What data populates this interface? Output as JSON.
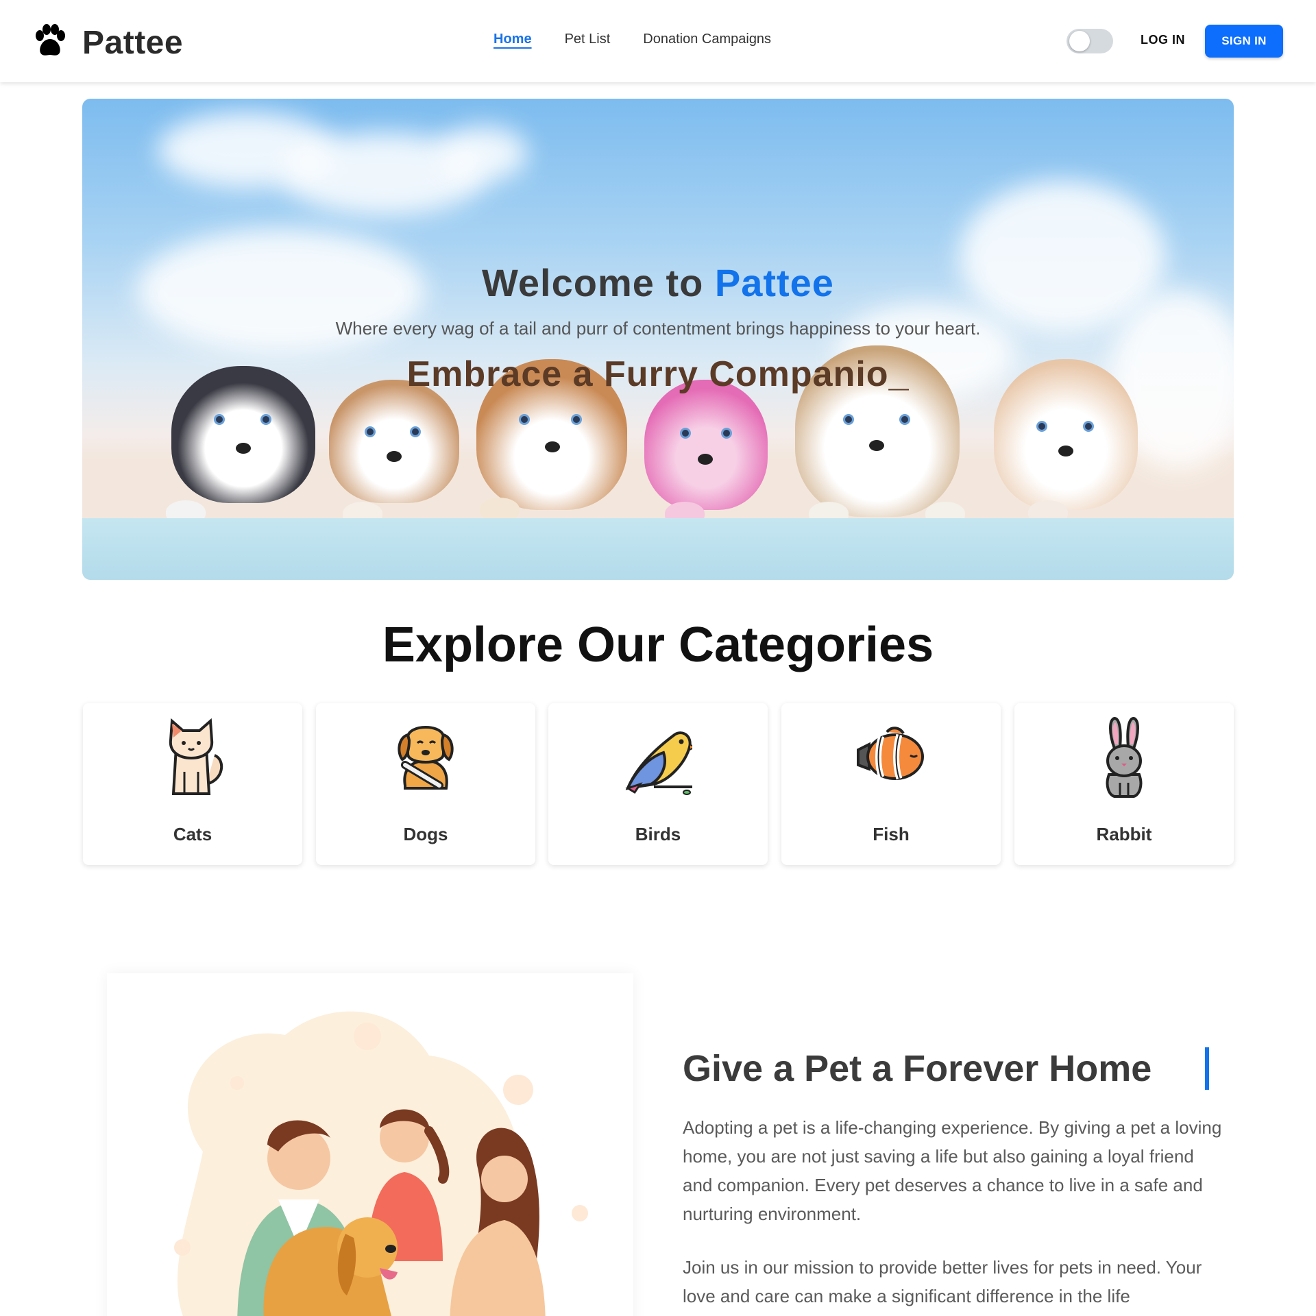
{
  "header": {
    "logo_text": "Pattee",
    "nav": [
      {
        "label": "Home",
        "active": true
      },
      {
        "label": "Pet List",
        "active": false
      },
      {
        "label": "Donation Campaigns",
        "active": false
      }
    ],
    "theme_toggle": {
      "checked": false
    },
    "login_label": "LOG IN",
    "signin_label": "SIGN IN",
    "accent_color": "#0d6efd"
  },
  "hero": {
    "title_prefix": "Welcome to ",
    "title_brand": "Pattee",
    "subtitle": "Where every wag of a tail and purr of contentment brings happiness to your heart.",
    "typed_text": "Embrace a Furry Companio_"
  },
  "categories": {
    "title": "Explore Our Categories",
    "items": [
      {
        "label": "Cats",
        "icon": "cat-icon"
      },
      {
        "label": "Dogs",
        "icon": "dog-icon"
      },
      {
        "label": "Birds",
        "icon": "bird-icon"
      },
      {
        "label": "Fish",
        "icon": "fish-icon"
      },
      {
        "label": "Rabbit",
        "icon": "rabbit-icon"
      }
    ]
  },
  "adopt": {
    "title": "Give a Pet a Forever Home",
    "paragraph1": "Adopting a pet is a life-changing experience. By giving a pet a loving home, you are not just saving a life but also gaining a loyal friend and companion. Every pet deserves a chance to live in a safe and nurturing environment.",
    "paragraph2": "Join us in our mission to provide better lives for pets in need. Your love and care can make a significant difference in the life"
  }
}
